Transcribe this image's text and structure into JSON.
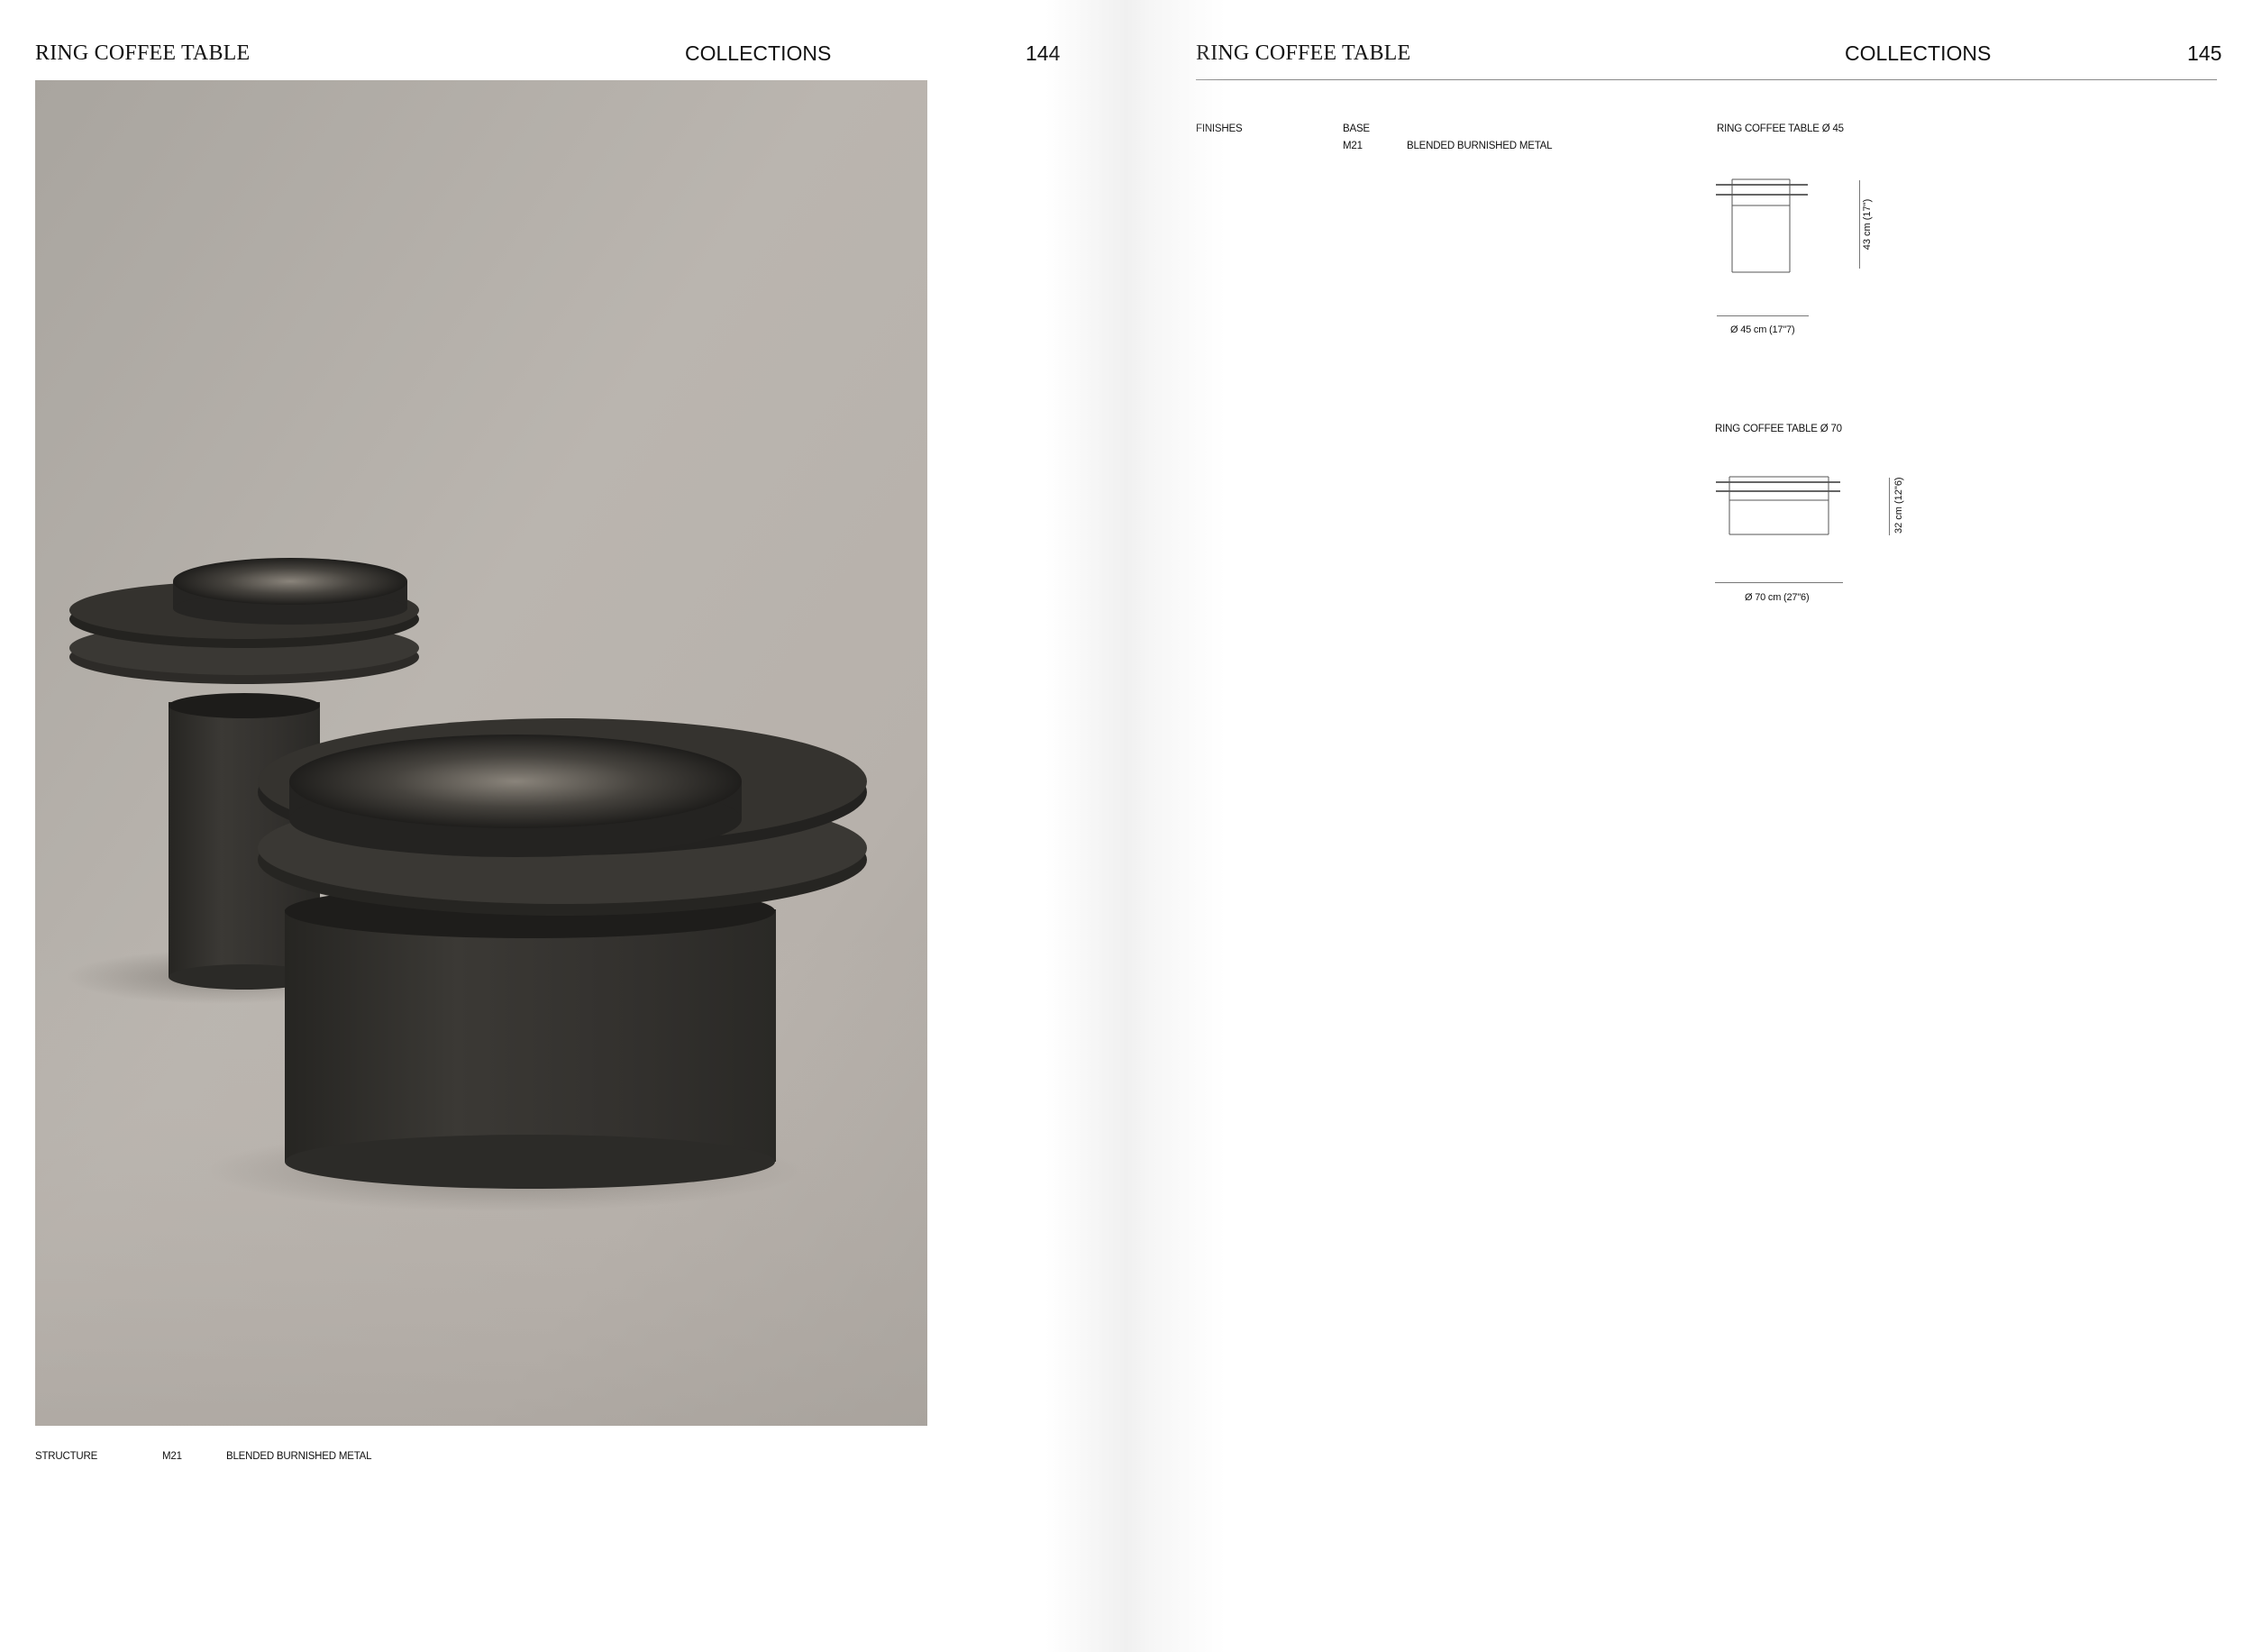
{
  "left_page": {
    "title": "RING COFFEE TABLE",
    "section": "COLLECTIONS",
    "page_number": "144",
    "caption": {
      "label": "STRUCTURE",
      "code": "M21",
      "finish": "BLENDED BURNISHED METAL"
    }
  },
  "right_page": {
    "title": "RING COFFEE TABLE",
    "section": "COLLECTIONS",
    "page_number": "145",
    "finishes": {
      "label": "FINISHES",
      "group": "BASE",
      "code": "M21",
      "finish": "BLENDED BURNISHED METAL"
    },
    "drawings": [
      {
        "name": "RING COFFEE TABLE Ø 45",
        "height_label": "43 cm (17\")",
        "width_label": "Ø 45 cm (17\"7)"
      },
      {
        "name": "RING COFFEE TABLE Ø 70",
        "height_label": "32 cm (12\"6)",
        "width_label": "Ø 70 cm (27\"6)"
      }
    ]
  }
}
